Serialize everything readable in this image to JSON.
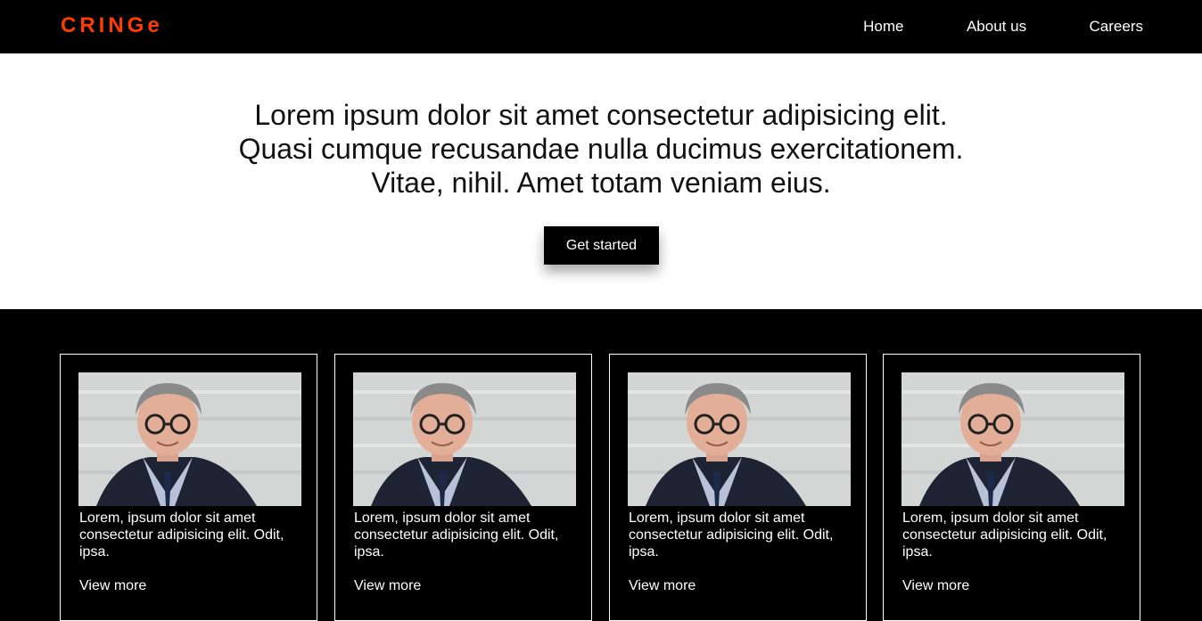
{
  "navbar": {
    "logo": "CRINGe",
    "links": [
      {
        "label": "Home"
      },
      {
        "label": "About us"
      },
      {
        "label": "Careers"
      }
    ]
  },
  "hero": {
    "text": "Lorem ipsum dolor sit amet consectetur adipisicing elit. Quasi cumque recusandae nulla ducimus exercitationem. Vitae, nihil. Amet totam veniam eius.",
    "cta_label": "Get started"
  },
  "cards": [
    {
      "text": "Lorem, ipsum dolor sit amet consectetur adipisicing elit. Odit, ipsa.",
      "more": "View more"
    },
    {
      "text": "Lorem, ipsum dolor sit amet consectetur adipisicing elit. Odit, ipsa.",
      "more": "View more"
    },
    {
      "text": "Lorem, ipsum dolor sit amet consectetur adipisicing elit. Odit, ipsa.",
      "more": "View more"
    },
    {
      "text": "Lorem, ipsum dolor sit amet consectetur adipisicing elit. Odit, ipsa.",
      "more": "View more"
    }
  ],
  "colors": {
    "brand": "#ff3d00",
    "navbar_bg": "#000000",
    "hero_bg": "#ffffff",
    "cards_bg": "#000000"
  }
}
